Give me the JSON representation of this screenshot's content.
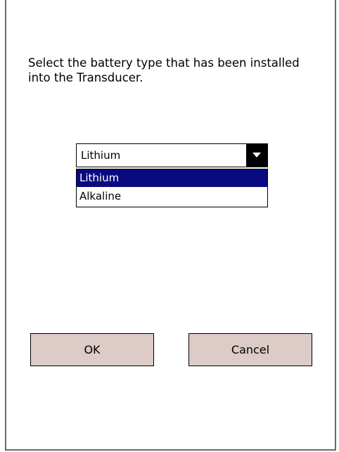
{
  "dialog": {
    "prompt": "Select the battery type that has been installed into the Transducer."
  },
  "battery_select": {
    "selected_value": "Lithium",
    "options": [
      "Lithium",
      "Alkaline"
    ],
    "highlighted_option": "Lithium"
  },
  "buttons": {
    "ok_label": "OK",
    "cancel_label": "Cancel"
  },
  "colors": {
    "button_bg": "#dccbc6",
    "selection_bg": "#0a0a80",
    "border": "#000000"
  },
  "icons": {
    "dropdown": "chevron-down-icon"
  }
}
